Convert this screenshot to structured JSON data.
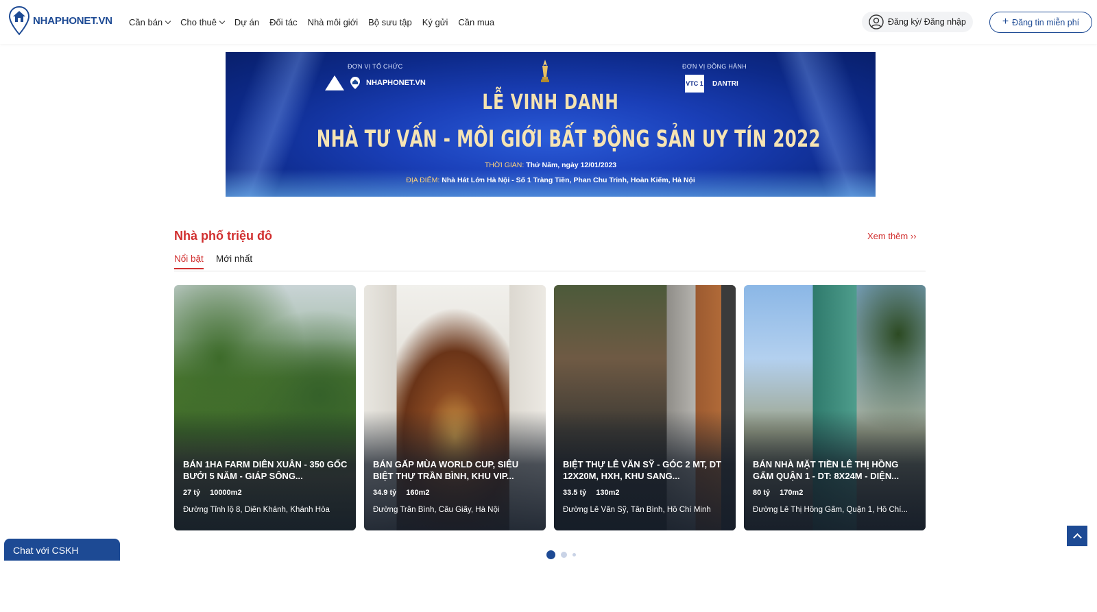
{
  "header": {
    "logo_text": "NHAPHONET.VN",
    "nav": [
      {
        "label": "Cần bán",
        "dropdown": true
      },
      {
        "label": "Cho thuê",
        "dropdown": true
      },
      {
        "label": "Dự án",
        "dropdown": false
      },
      {
        "label": "Đối tác",
        "dropdown": false
      },
      {
        "label": "Nhà môi giới",
        "dropdown": false
      },
      {
        "label": "Bộ sưu tập",
        "dropdown": false
      },
      {
        "label": "Ký gửi",
        "dropdown": false
      },
      {
        "label": "Cần mua",
        "dropdown": false
      }
    ],
    "login_label": "Đăng ký/ Đăng nhập",
    "post_label": "Đăng tin miễn phí",
    "brand_color": "#1d4a94"
  },
  "banner": {
    "organizer_label": "ĐƠN VỊ TỔ CHỨC",
    "organizer_name": "NHAPHONET.VN",
    "partner_label": "ĐƠN VỊ ĐỒNG HÀNH",
    "partner_vtc": "VTC 1",
    "partner_dantri": "DANTRI",
    "title_line1": "LỄ VINH DANH",
    "title_line2": "NHÀ TƯ VẤN - MÔI GIỚI BẤT ĐỘNG SẢN UY TÍN 2022",
    "time_label": "THỜI GIAN:",
    "time_value": "Thứ Năm, ngày 12/01/2023",
    "place_label": "ĐỊA ĐIỂM:",
    "place_value": "Nhà Hát Lớn Hà Nội - Số 1 Tràng Tiền, Phan Chu Trinh, Hoàn Kiếm, Hà Nội"
  },
  "section": {
    "title": "Nhà phố triệu đô",
    "see_more": "Xem thêm",
    "tabs": [
      "Nổi bật",
      "Mới nhất"
    ],
    "active_tab": "Nổi bật",
    "accent_color": "#d12f2f"
  },
  "cards": [
    {
      "title": "BÁN 1HA FARM DIÊN XUÂN - 350 GỐC BƯỞI 5 NĂM - GIÁP SÔNG...",
      "price": "27 tỷ",
      "area": "10000m2",
      "address": "Đường Tỉnh lộ 8, Diên Khánh, Khánh Hòa"
    },
    {
      "title": "BÁN GẤP MÙA WORLD CUP, SIÊU BIỆT THỰ TRẦN BÌNH, KHU VIP...",
      "price": "34.9 tỷ",
      "area": "160m2",
      "address": "Đường Trần Bình, Cầu Giấy, Hà Nội"
    },
    {
      "title": "BIỆT THỰ LÊ VĂN SỸ - GÓC 2 MT, DT 12X20M, HXH, KHU SANG...",
      "price": "33.5 tỷ",
      "area": "130m2",
      "address": "Đường Lê Văn Sỹ, Tân Bình, Hồ Chí Minh"
    },
    {
      "title": "BÁN NHÀ MẶT TIỀN LÊ THỊ HỒNG GẤM QUẬN 1 - DT: 8X24M - DIỆN...",
      "price": "80 tỷ",
      "area": "170m2",
      "address": "Đường Lê Thị Hồng Gấm, Quận 1, Hồ Chí..."
    }
  ],
  "pagination": {
    "pages": 3,
    "active": 1
  },
  "chat_label": "Chat với CSKH"
}
